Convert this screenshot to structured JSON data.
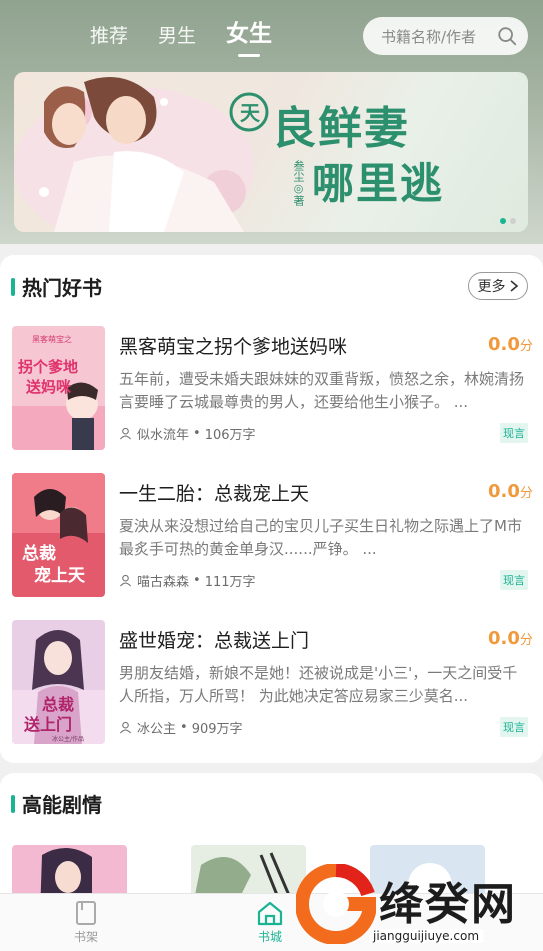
{
  "header": {
    "tabs": [
      {
        "label": "推荐",
        "active": false
      },
      {
        "label": "男生",
        "active": false
      },
      {
        "label": "女生",
        "active": true
      }
    ],
    "search": {
      "placeholder": "书籍名称/作者",
      "icon": "search-icon"
    }
  },
  "banner": {
    "title_line1": "良鲜妻",
    "title_line2": "哪里逃",
    "author_mark": "叁尘◎著",
    "carousel": {
      "count": 2,
      "active_index": 0
    }
  },
  "hot_section": {
    "title": "热门好书",
    "more_label": "更多",
    "books": [
      {
        "title": "黑客萌宝之拐个爹地送妈咪",
        "score": "0.0",
        "score_unit": "分",
        "desc": "五年前，遭受未婚夫跟妹妹的双重背叛，愤怒之余，林婉清扬言要睡了云城最尊贵的男人，还要给他生小猴子。 ...",
        "author": "似水流年",
        "words": "106万字",
        "tag": "现言",
        "cover_text": "拐个爹地送妈咪",
        "cover_sub": "黑客萌宝之"
      },
      {
        "title": "一生二胎：总裁宠上天",
        "score": "0.0",
        "score_unit": "分",
        "desc": "夏泱从来没想过给自己的宝贝儿子买生日礼物之际遇上了M市最炙手可热的黄金单身汉......严铮。 ...",
        "author": "喵古森森",
        "words": "111万字",
        "tag": "现言",
        "cover_text": "总裁宠上天"
      },
      {
        "title": "盛世婚宠：总裁送上门",
        "score": "0.0",
        "score_unit": "分",
        "desc": "男朋友结婚，新娘不是她！还被说成是'小三'，一天之间受千人所指，万人所骂！ 为此她决定答应易家三少莫名...",
        "author": "冰公主",
        "words": "909万字",
        "tag": "现言",
        "cover_text": "总裁送上门",
        "cover_sub": "冰公主/作品"
      }
    ]
  },
  "highlight_section": {
    "title": "高能剧情"
  },
  "bottom_nav": {
    "items": [
      {
        "label": "书架",
        "icon": "bookshelf-icon",
        "active": false
      },
      {
        "label": "书城",
        "icon": "home-icon",
        "active": true
      }
    ]
  },
  "watermark": {
    "text": "绛癸网",
    "url": "jiangguijiuye.com"
  },
  "colors": {
    "accent": "#1ab394",
    "score": "#f09a3e"
  }
}
